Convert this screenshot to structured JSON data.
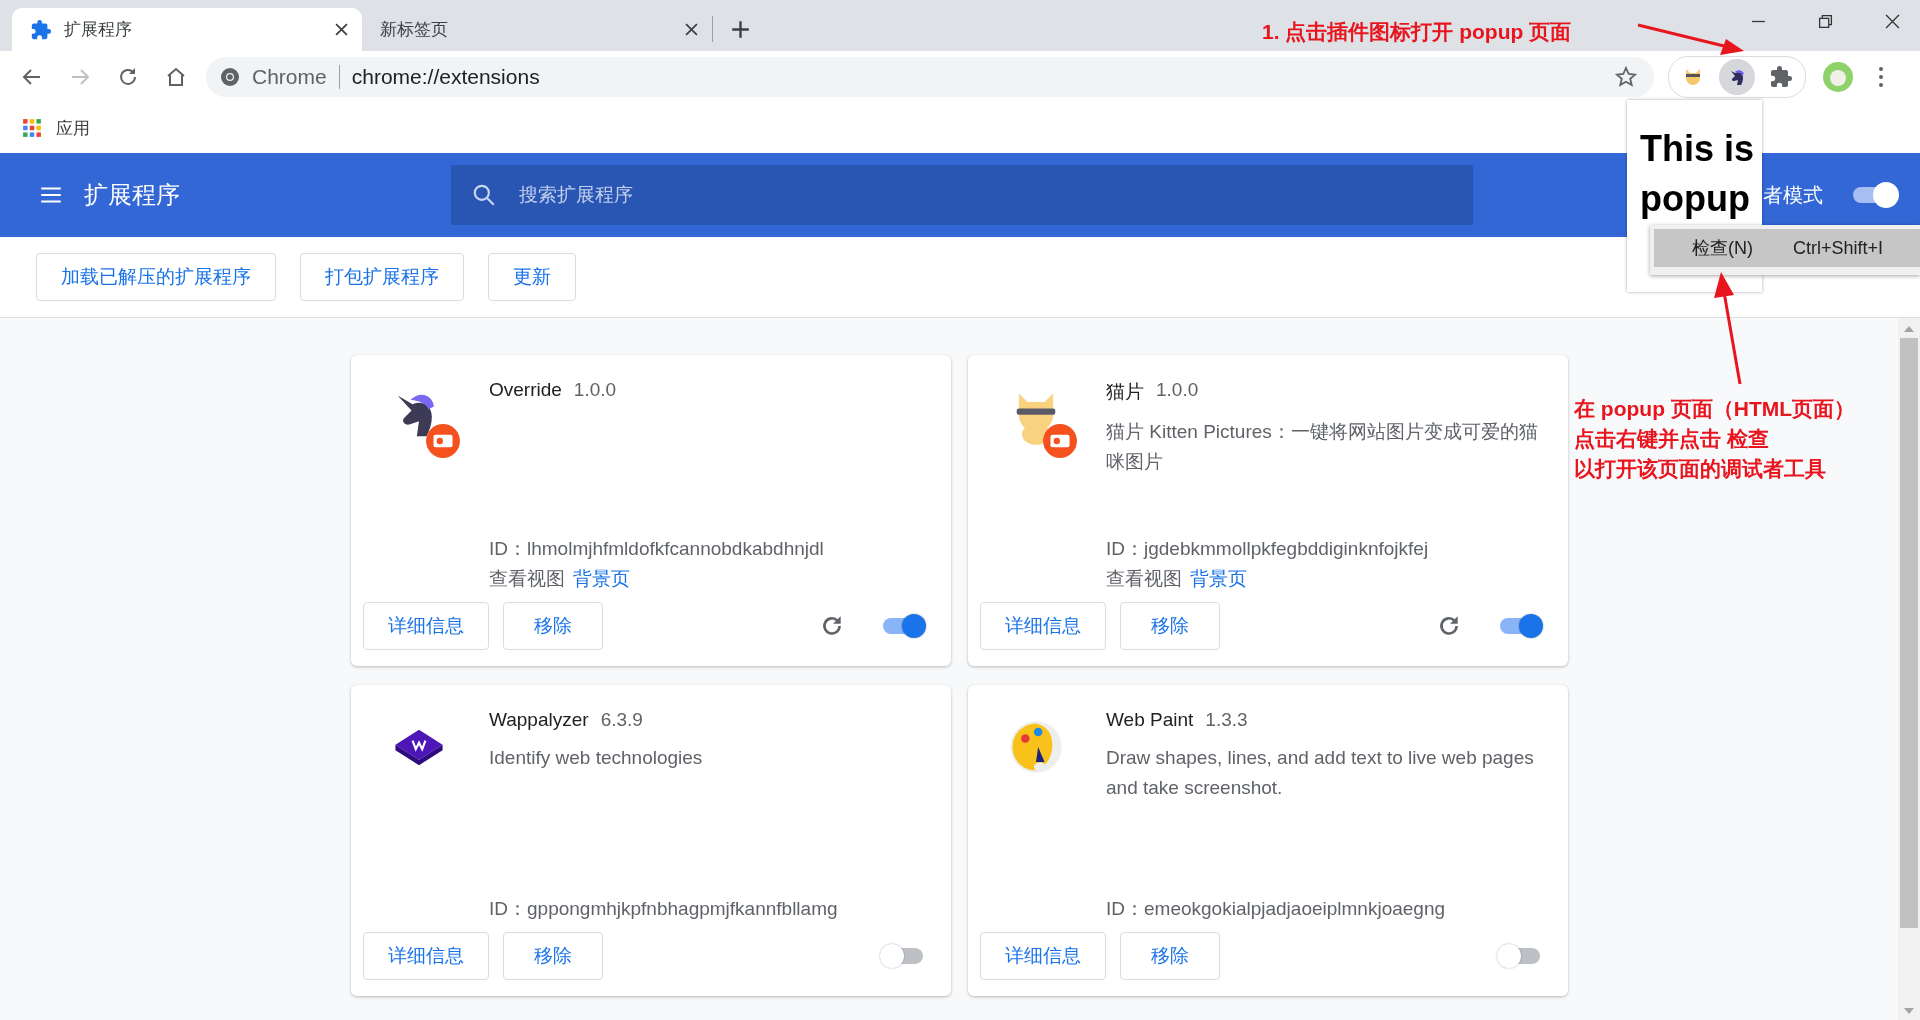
{
  "tabs": [
    {
      "title": "扩展程序",
      "selected": true
    },
    {
      "title": "新标签页",
      "selected": false
    }
  ],
  "address_bar": {
    "site_label": "Chrome",
    "url": "chrome://extensions"
  },
  "bookmarks": [
    {
      "label": "应用"
    }
  ],
  "header": {
    "title": "扩展程序",
    "search_placeholder": "搜索扩展程序",
    "dev_mode_label": "者模式",
    "dev_mode_on": true
  },
  "actions": [
    "加载已解压的扩展程序",
    "打包扩展程序",
    "更新"
  ],
  "extensions": [
    {
      "name": "Override",
      "version": "1.0.0",
      "id": "ID：lhmolmjhfmldofkfcannobdkabdhnjdl",
      "views_label": "查看视图",
      "view_link": "背景页",
      "details": "详细信息",
      "remove": "移除",
      "unpacked": true,
      "enabled": true
    },
    {
      "name": "猫片",
      "version": "1.0.0",
      "description": "猫片 Kitten Pictures：一键将网站图片变成可爱的猫咪图片",
      "id": "ID：jgdebkmmollpkfegbddiginknfojkfej",
      "views_label": "查看视图",
      "view_link": "背景页",
      "details": "详细信息",
      "remove": "移除",
      "unpacked": true,
      "enabled": true
    },
    {
      "name": "Wappalyzer",
      "version": "6.3.9",
      "description": "Identify web technologies",
      "id": "ID：gppongmhjkpfnbhagpmjfkannfbllamg",
      "details": "详细信息",
      "remove": "移除",
      "unpacked": false,
      "enabled": false
    },
    {
      "name": "Web Paint",
      "version": "1.3.3",
      "description": "Draw shapes, lines, and add text to live web pages and take screenshot.",
      "id": "ID：emeokgokialpjadjaoeiplmnkjoaegng",
      "details": "详细信息",
      "remove": "移除",
      "unpacked": false,
      "enabled": false
    }
  ],
  "popup": {
    "text": "This is popup"
  },
  "context_menu": {
    "items": [
      {
        "label": "检查(N)",
        "shortcut": "Ctrl+Shift+I",
        "selected": true
      }
    ]
  },
  "annotations": [
    {
      "lines": [
        "1. 点击插件图标打开 popup 页面"
      ]
    },
    {
      "lines": [
        "在 popup 页面（HTML页面）",
        "点击右键并点击 检查",
        "以打开该页面的调试者工具"
      ]
    }
  ]
}
